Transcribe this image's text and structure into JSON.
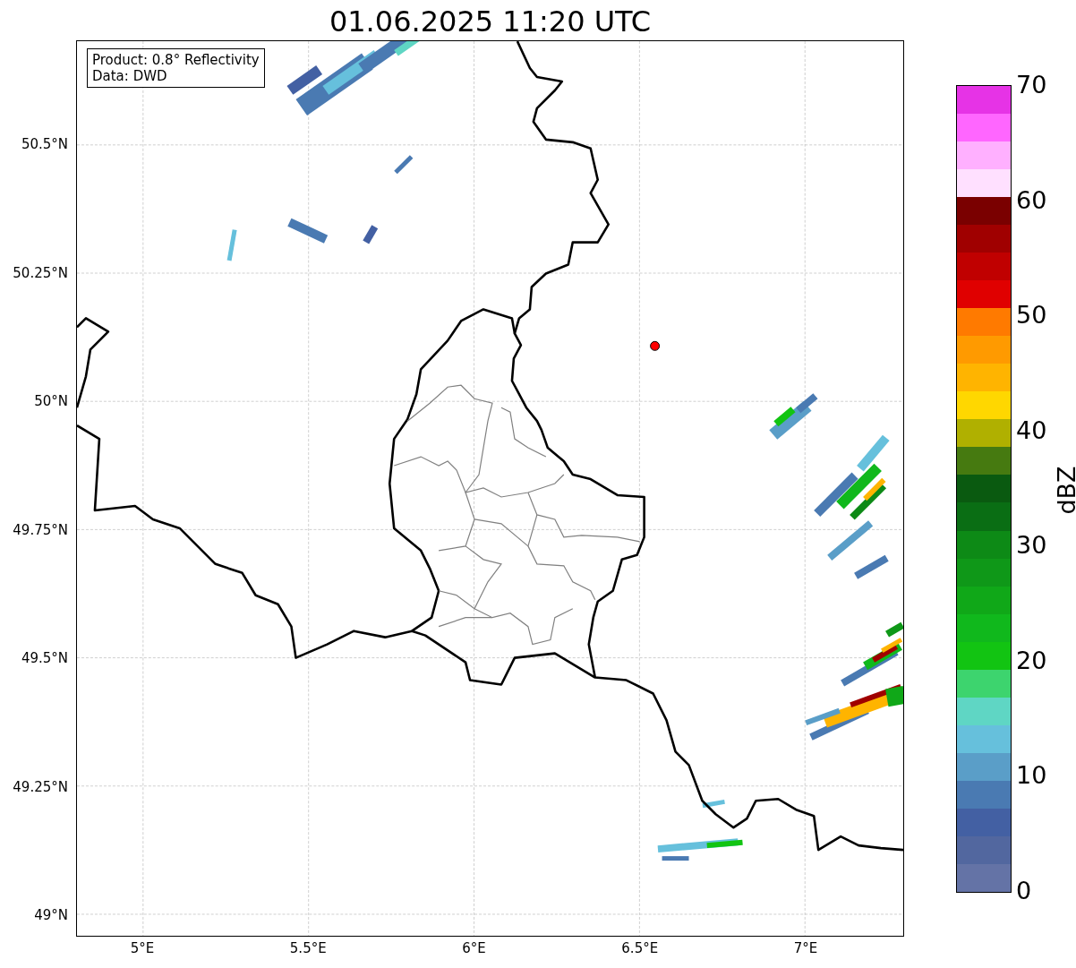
{
  "title": "01.06.2025 11:20 UTC",
  "info_box": [
    "Product: 0.8° Reflectivity",
    "Data: DWD"
  ],
  "x_ticks": [
    "5°E",
    "5.5°E",
    "6°E",
    "6.5°E",
    "7°E"
  ],
  "y_ticks": [
    "50.5°N",
    "50.25°N",
    "50°N",
    "49.75°N",
    "49.5°N",
    "49.25°N",
    "49°N"
  ],
  "colorbar": {
    "label": "dBZ",
    "ticks": [
      "70",
      "60",
      "50",
      "40",
      "30",
      "20",
      "10",
      "0"
    ],
    "segments": [
      {
        "color": "#e633e6"
      },
      {
        "color": "#ff66ff"
      },
      {
        "color": "#ffb0ff"
      },
      {
        "color": "#ffe0ff"
      },
      {
        "color": "#7a0000"
      },
      {
        "color": "#a00000"
      },
      {
        "color": "#c00000"
      },
      {
        "color": "#e00000"
      },
      {
        "color": "#ff7a00"
      },
      {
        "color": "#ff9a00"
      },
      {
        "color": "#ffb400"
      },
      {
        "color": "#ffd700"
      },
      {
        "color": "#b0b000"
      },
      {
        "color": "#467a10"
      },
      {
        "color": "#0a5a10"
      },
      {
        "color": "#0a6e14"
      },
      {
        "color": "#0d8a16"
      },
      {
        "color": "#0f9818"
      },
      {
        "color": "#10a818"
      },
      {
        "color": "#10b81c"
      },
      {
        "color": "#12c412"
      },
      {
        "color": "#3dd46e"
      },
      {
        "color": "#5fd6c4"
      },
      {
        "color": "#66c0dc"
      },
      {
        "color": "#5a9ec8"
      },
      {
        "color": "#4a7ab2"
      },
      {
        "color": "#4360a3"
      },
      {
        "color": "#52679f"
      },
      {
        "color": "#6473a6"
      }
    ]
  }
}
